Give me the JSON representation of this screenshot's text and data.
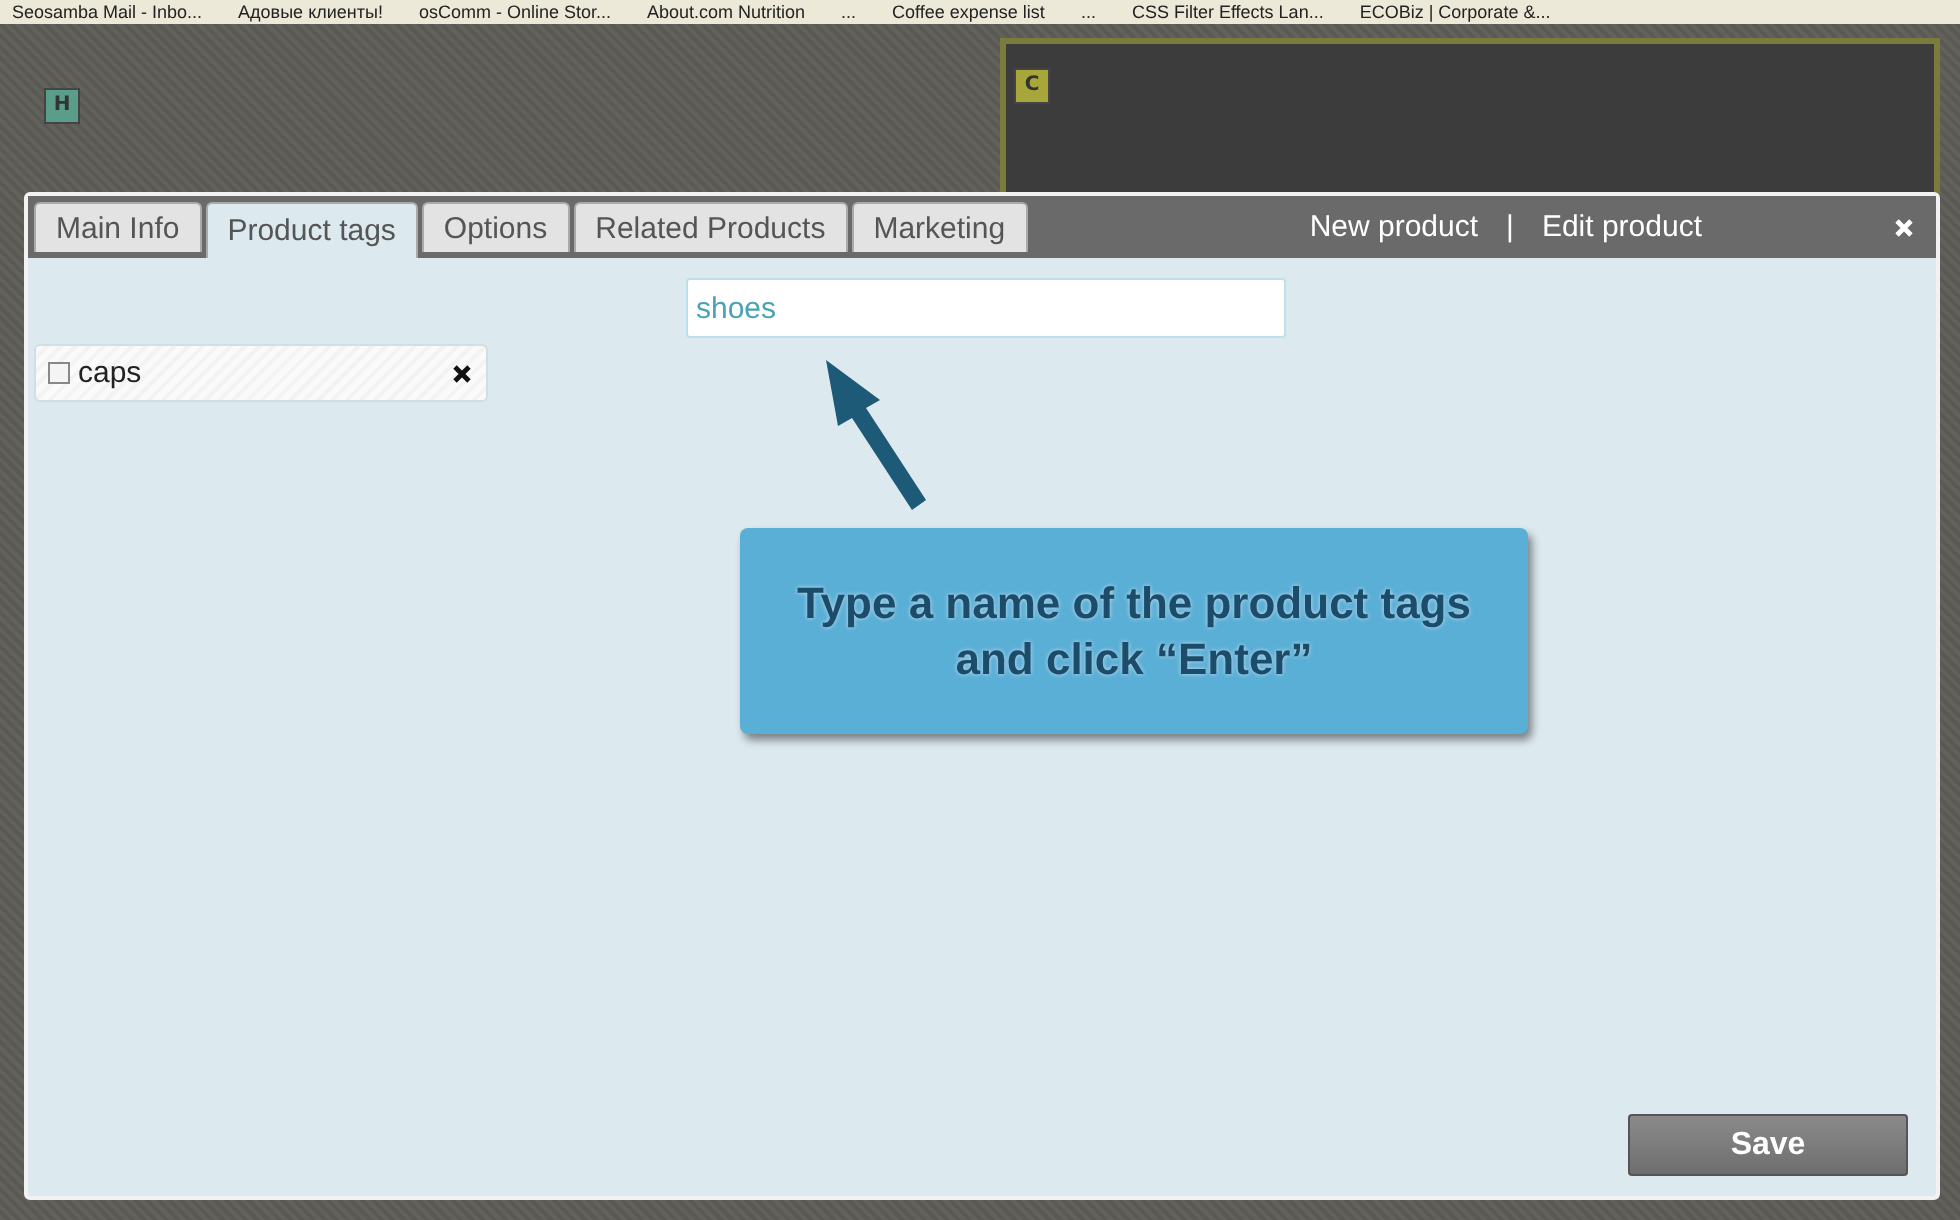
{
  "bookmarks": [
    {
      "label": "Seosamba Mail - Inbo..."
    },
    {
      "label": "Адовые клиенты!"
    },
    {
      "label": "osComm - Online Stor..."
    },
    {
      "label": "About.com Nutrition"
    },
    {
      "label": "..."
    },
    {
      "label": "Coffee expense list"
    },
    {
      "label": "..."
    },
    {
      "label": "CSS Filter Effects Lan..."
    },
    {
      "label": "ECOBiz | Corporate &..."
    }
  ],
  "background_badges": [
    {
      "letter": "H",
      "color": "#5a9e8a"
    },
    {
      "letter": "C",
      "color": "#a6a63a"
    }
  ],
  "dialog": {
    "tabs": [
      {
        "label": "Main Info",
        "selected": false
      },
      {
        "label": "Product tags",
        "selected": true
      },
      {
        "label": "Options",
        "selected": false
      },
      {
        "label": "Related Products",
        "selected": false
      },
      {
        "label": "Marketing",
        "selected": false
      }
    ],
    "header_links": [
      "New product",
      "Edit product"
    ],
    "separator": "|",
    "tag_input": {
      "value": "shoes"
    },
    "tags": [
      {
        "label": "caps",
        "checked": false
      }
    ],
    "callout": "Type a name of the product tags and click “Enter”",
    "save_button": "Save"
  }
}
